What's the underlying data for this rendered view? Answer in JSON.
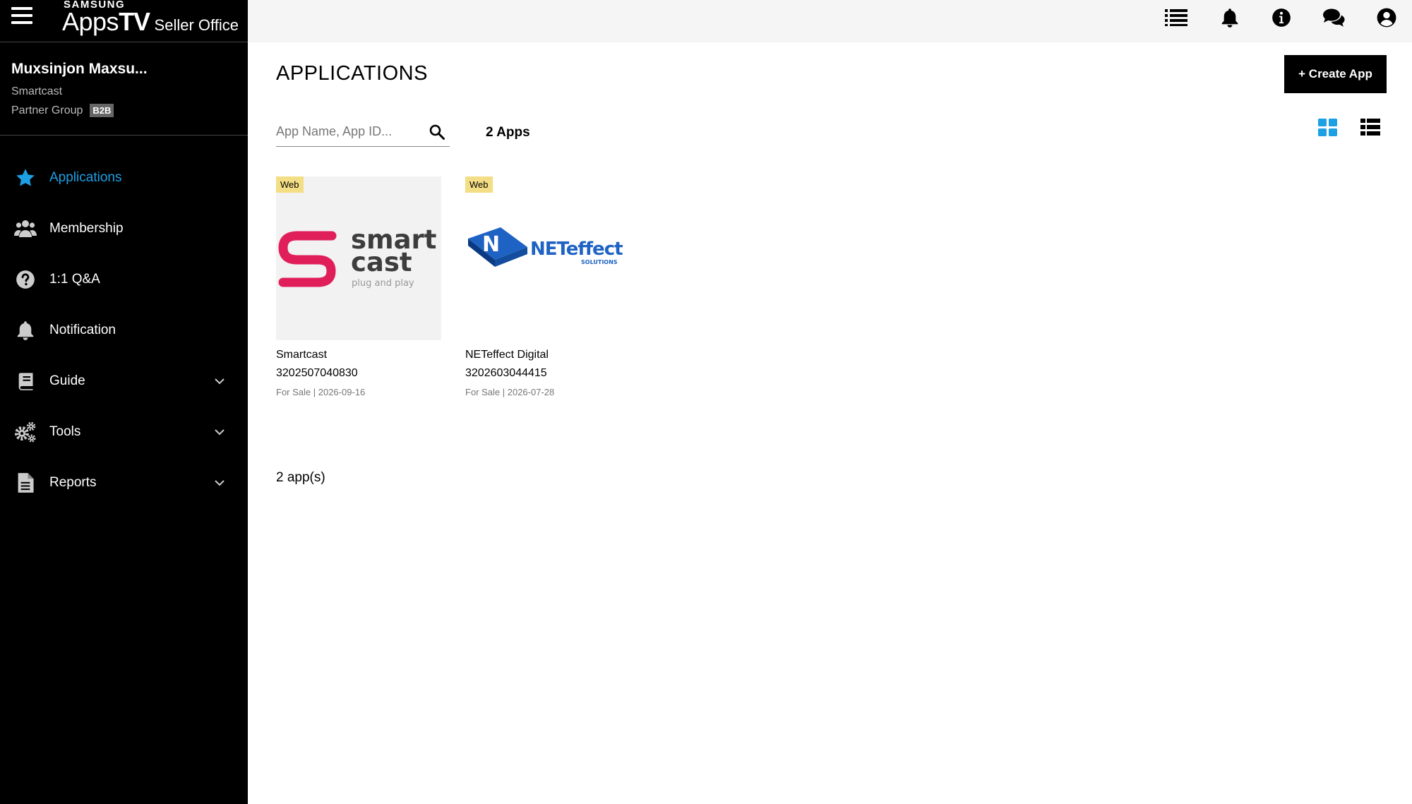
{
  "brand": {
    "samsung": "SAMSUNG",
    "apps": "Apps",
    "tv": "TV",
    "seller_office": "Seller Office"
  },
  "user": {
    "name": "Muxsinjon Maxsu...",
    "org": "Smartcast",
    "group": "Partner Group",
    "badge": "B2B"
  },
  "nav": {
    "items": [
      {
        "label": "Applications",
        "icon": "star-icon",
        "active": true
      },
      {
        "label": "Membership",
        "icon": "users-icon"
      },
      {
        "label": "1:1 Q&A",
        "icon": "question-circle-icon"
      },
      {
        "label": "Notification",
        "icon": "bell-icon"
      },
      {
        "label": "Guide",
        "icon": "book-icon",
        "expandable": true
      },
      {
        "label": "Tools",
        "icon": "gears-icon",
        "expandable": true
      },
      {
        "label": "Reports",
        "icon": "document-icon",
        "expandable": true
      }
    ]
  },
  "topbar": {
    "icons": [
      "list-icon",
      "bell-icon",
      "info-icon",
      "chat-icon",
      "account-icon"
    ]
  },
  "main": {
    "title": "APPLICATIONS",
    "create_label": "+ Create App",
    "search_placeholder": "App Name, App ID...",
    "count_label": "2 Apps",
    "footer_count": "2 app(s)",
    "accent": "#1ca0e3"
  },
  "apps": [
    {
      "badge": "Web",
      "logo_line1": "smart",
      "logo_line2": "cast",
      "logo_tagline": "plug and play",
      "name": "Smartcast",
      "id": "3202507040830",
      "status": "For Sale | 2026-09-16"
    },
    {
      "badge": "Web",
      "logo_text": "NETeffect",
      "logo_sub": "SOLUTIONS",
      "name": "NETeffect Digital",
      "id": "3202603044415",
      "status": "For Sale | 2026-07-28"
    }
  ]
}
